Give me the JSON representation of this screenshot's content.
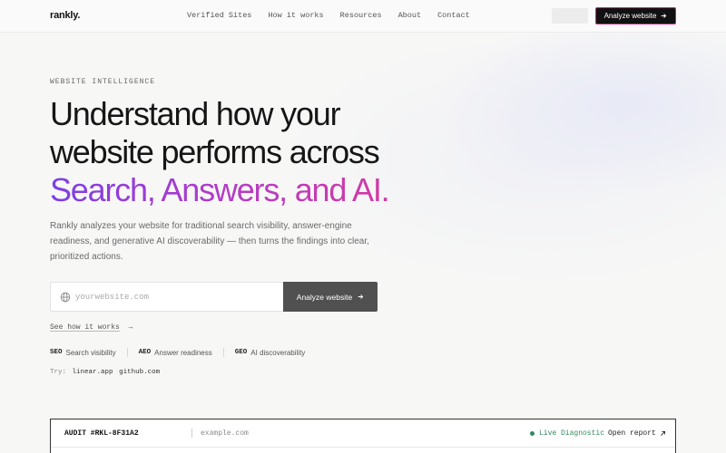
{
  "nav": {
    "logo": "rankly.",
    "links": [
      "Verified Sites",
      "How it works",
      "Resources",
      "About",
      "Contact"
    ],
    "cta_label": "Analyze website",
    "cta_icon": "arrow-right-icon"
  },
  "hero": {
    "eyebrow": "WEBSITE INTELLIGENCE",
    "headline_line1": "Understand how your",
    "headline_line2": "website performs across",
    "headline_gradient": "Search, Answers, and AI.",
    "subtext": "Rankly analyzes your website for traditional search visibility, answer-engine readiness, and generative AI discoverability — then turns the findings into clear, prioritized actions.",
    "search": {
      "placeholder": "yourwebsite.com",
      "value": "",
      "button_label": "Analyze website"
    },
    "see_how": "See how it works",
    "features": [
      {
        "abbr": "SEO",
        "label": "Search visibility"
      },
      {
        "abbr": "AEO",
        "label": "Answer readiness"
      },
      {
        "abbr": "GEO",
        "label": "AI discoverability"
      }
    ],
    "try_label": "Try:",
    "try_examples": [
      "linear.app",
      "github.com"
    ]
  },
  "audit": {
    "id": "AUDIT #RKL-8F31A2",
    "domain": "example.com",
    "status": "Live Diagnostic",
    "open_label": "Open report"
  },
  "colors": {
    "accent_gradient_start": "#7b3fe4",
    "accent_gradient_end": "#d93a9a",
    "cta_border": "#c2297f",
    "status_green": "#2f8a5c"
  }
}
